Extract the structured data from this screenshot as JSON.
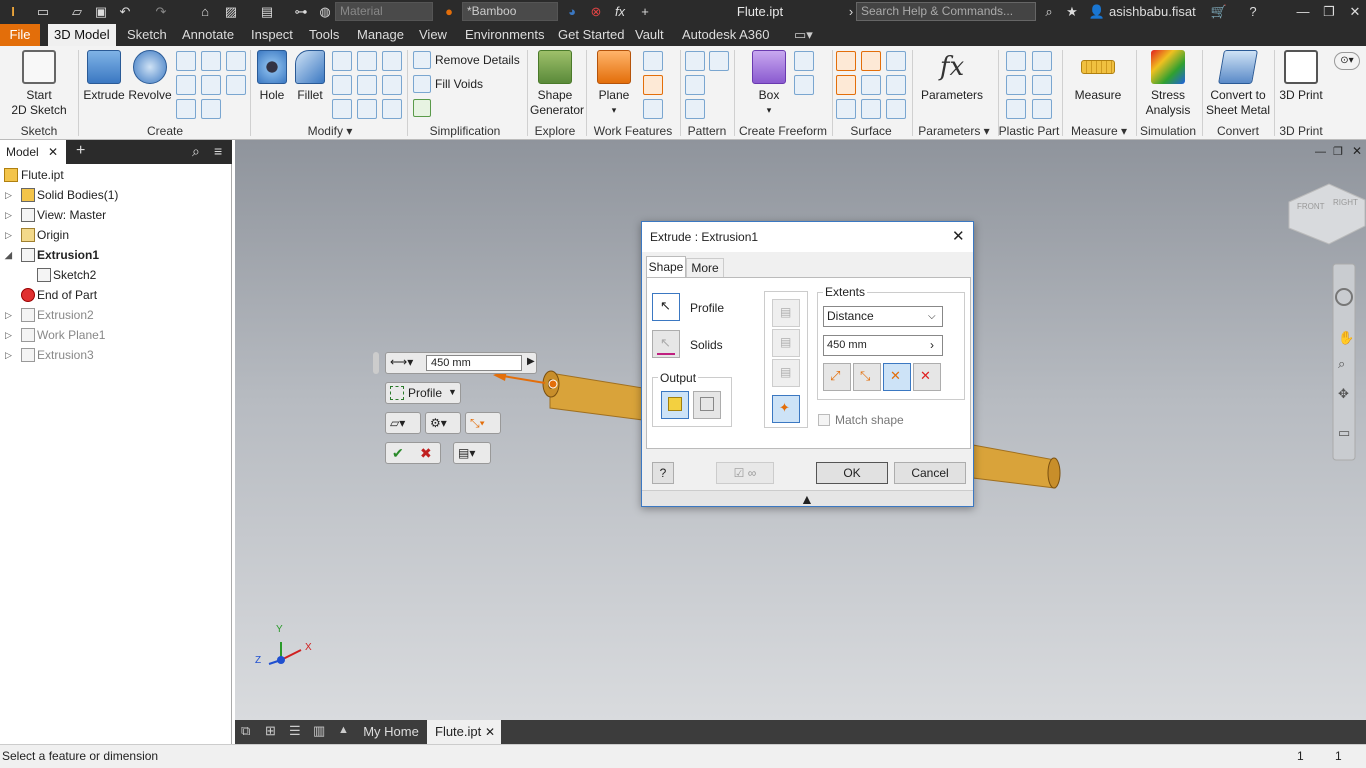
{
  "app": {
    "doc_title": "Flute.ipt",
    "search_placeholder": "Search Help & Commands...",
    "user": "asishbabu.fisat",
    "material": "Material",
    "appearance": "*Bamboo"
  },
  "menu": {
    "tabs": [
      "File",
      "3D Model",
      "Sketch",
      "Annotate",
      "Inspect",
      "Tools",
      "Manage",
      "View",
      "Environments",
      "Get Started",
      "Vault",
      "Autodesk A360"
    ],
    "active": "3D Model"
  },
  "ribbon": {
    "start_sketch": "Start\n2D Sketch",
    "start_sketch_l1": "Start",
    "start_sketch_l2": "2D Sketch",
    "extrude": "Extrude",
    "revolve": "Revolve",
    "hole": "Hole",
    "fillet": "Fillet",
    "remove_details": "Remove Details",
    "fill_voids": "Fill Voids",
    "shape_gen_l1": "Shape",
    "shape_gen_l2": "Generator",
    "plane": "Plane",
    "box": "Box",
    "parameters": "Parameters",
    "measure": "Measure",
    "stress_l1": "Stress",
    "stress_l2": "Analysis",
    "convert_l1": "Convert to",
    "convert_l2": "Sheet Metal",
    "print3d": "3D Print",
    "panels": {
      "sketch": "Sketch",
      "create": "Create",
      "modify": "Modify",
      "simplification": "Simplification",
      "explore": "Explore",
      "work_features": "Work Features",
      "pattern": "Pattern",
      "create_freeform": "Create Freeform",
      "surface": "Surface",
      "parameters": "Parameters",
      "plastic_part": "Plastic Part",
      "measure": "Measure",
      "simulation": "Simulation",
      "convert": "Convert",
      "print3d": "3D Print"
    }
  },
  "browser": {
    "tab": "Model",
    "items": [
      {
        "label": "Flute.ipt",
        "icon": "part-icon"
      },
      {
        "label": "Solid Bodies(1)",
        "icon": "solid-bodies-icon"
      },
      {
        "label": "View: Master",
        "icon": "view-icon"
      },
      {
        "label": "Origin",
        "icon": "folder-icon"
      },
      {
        "label": "Extrusion1",
        "icon": "extrude-feature-icon"
      },
      {
        "label": "Sketch2",
        "icon": "sketch-icon"
      },
      {
        "label": "End of Part",
        "icon": "end-of-part-icon"
      },
      {
        "label": "Extrusion2",
        "icon": "extrude-feature-icon"
      },
      {
        "label": "Work Plane1",
        "icon": "work-plane-icon"
      },
      {
        "label": "Extrusion3",
        "icon": "extrude-feature-icon"
      }
    ]
  },
  "mini_toolbar": {
    "distance": "450 mm",
    "profile": "Profile"
  },
  "dialog": {
    "title": "Extrude : Extrusion1",
    "tabs": [
      "Shape",
      "More"
    ],
    "profile": "Profile",
    "solids": "Solids",
    "output": "Output",
    "extents": "Extents",
    "extents_type": "Distance",
    "distance": "450 mm",
    "match_shape": "Match shape",
    "ok": "OK",
    "cancel": "Cancel"
  },
  "doc_tabs": {
    "home": "My Home",
    "file": "Flute.ipt"
  },
  "status": {
    "message": "Select a feature or dimension",
    "count1": "1",
    "count2": "1"
  },
  "triad": {
    "x": "X",
    "y": "Y",
    "z": "Z"
  },
  "viewcube": {
    "front": "FRONT",
    "right": "RIGHT"
  },
  "colors": {
    "accent_file": "#e36e0a",
    "bamboo": "#d9a33a",
    "dialog_border": "#3b78c2"
  }
}
